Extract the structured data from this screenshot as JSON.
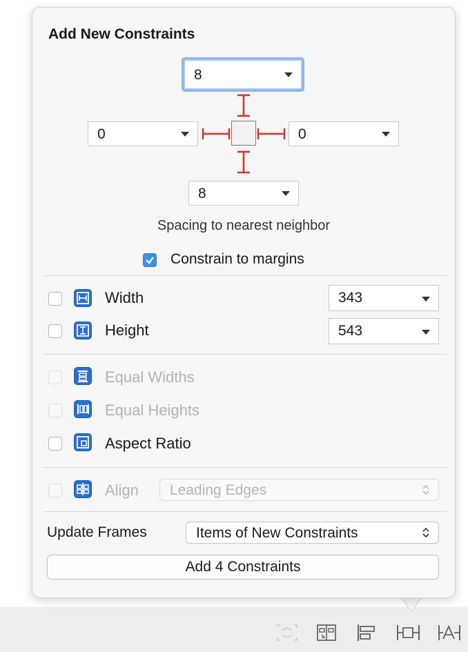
{
  "popover": {
    "title": "Add New Constraints",
    "spacing": {
      "top": "8",
      "left": "0",
      "right": "0",
      "bottom": "8",
      "caption": "Spacing to nearest neighbor"
    },
    "constrain_to_margins": {
      "label": "Constrain to margins",
      "checked": true
    },
    "width": {
      "label": "Width",
      "value": "343",
      "checked": false
    },
    "height": {
      "label": "Height",
      "value": "543",
      "checked": false
    },
    "equal_widths": {
      "label": "Equal Widths",
      "enabled": false
    },
    "equal_heights": {
      "label": "Equal Heights",
      "enabled": false
    },
    "aspect_ratio": {
      "label": "Aspect Ratio",
      "checked": false
    },
    "align": {
      "label": "Align",
      "value": "Leading Edges",
      "enabled": false
    },
    "update_frames": {
      "label": "Update Frames",
      "value": "Items of New Constraints"
    },
    "add_button": "Add 4 Constraints"
  },
  "toolbar": {
    "icons": [
      "update-frames-icon",
      "stack-icon",
      "align-icon",
      "add-constraints-icon",
      "resolve-issues-icon"
    ]
  },
  "colors": {
    "accent": "#3b8ef0",
    "constraint_red": "#d9302b",
    "icon_blue": "#2b6fd0"
  }
}
